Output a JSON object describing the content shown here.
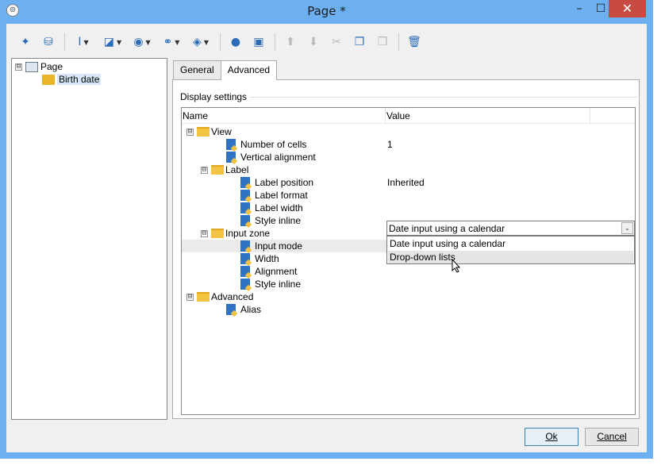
{
  "window": {
    "title": "Page *",
    "minimize_glyph": "–",
    "maximize_glyph": "☐",
    "close_glyph": "✕"
  },
  "toolbar": {
    "buttons": [
      {
        "name": "wizard-icon",
        "glyph": "✦",
        "enabled": true
      },
      {
        "name": "database-icon",
        "glyph": "⛁",
        "enabled": true
      },
      {
        "name": "text-cursor-icon",
        "glyph": "I",
        "enabled": true,
        "dropdown": true
      },
      {
        "name": "shapes-icon",
        "glyph": "◪",
        "enabled": true,
        "dropdown": true
      },
      {
        "name": "globe-icon",
        "glyph": "◉",
        "enabled": true,
        "dropdown": true
      },
      {
        "name": "link-icon",
        "glyph": "⚭",
        "enabled": true,
        "dropdown": true
      },
      {
        "name": "cube-icon",
        "glyph": "◈",
        "enabled": true,
        "dropdown": true
      },
      {
        "name": "user-icon",
        "glyph": "●",
        "enabled": true
      },
      {
        "name": "add-element-icon",
        "glyph": "▣",
        "enabled": true
      },
      {
        "name": "move-up-icon",
        "glyph": "⬆",
        "enabled": false
      },
      {
        "name": "move-down-icon",
        "glyph": "⬇",
        "enabled": false
      },
      {
        "name": "cut-icon",
        "glyph": "✂",
        "enabled": false
      },
      {
        "name": "copy-icon",
        "glyph": "❐",
        "enabled": true
      },
      {
        "name": "paste-icon",
        "glyph": "❒",
        "enabled": false
      },
      {
        "name": "delete-icon",
        "glyph": "🗑",
        "enabled": true
      }
    ]
  },
  "tree": {
    "root_label": "Page",
    "child_label": "Birth date",
    "root_expander": "⊟"
  },
  "tabs": [
    {
      "label": "General",
      "active": false
    },
    {
      "label": "Advanced",
      "active": true
    }
  ],
  "display_settings": {
    "group_label": "Display settings",
    "columns": {
      "name": "Name",
      "value": "Value"
    },
    "rows": [
      {
        "label": "View",
        "kind": "folder",
        "level": 0,
        "expander": "⊟",
        "value": ""
      },
      {
        "label": "Number of cells",
        "kind": "prop",
        "level": 1,
        "value": "1"
      },
      {
        "label": "Vertical alignment",
        "kind": "prop",
        "level": 1,
        "value": ""
      },
      {
        "label": "Label",
        "kind": "folder",
        "level": 1,
        "expander": "⊟",
        "value": ""
      },
      {
        "label": "Label position",
        "kind": "prop",
        "level": 2,
        "value": "Inherited"
      },
      {
        "label": "Label format",
        "kind": "prop",
        "level": 2,
        "value": ""
      },
      {
        "label": "Label width",
        "kind": "prop",
        "level": 2,
        "value": ""
      },
      {
        "label": "Style inline",
        "kind": "prop",
        "level": 2,
        "value": ""
      },
      {
        "label": "Input zone",
        "kind": "folder",
        "level": 1,
        "expander": "⊟",
        "value": ""
      },
      {
        "label": "Input mode",
        "kind": "prop",
        "level": 2,
        "value": "",
        "highlight": true
      },
      {
        "label": "Width",
        "kind": "prop",
        "level": 2,
        "value": ""
      },
      {
        "label": "Alignment",
        "kind": "prop",
        "level": 2,
        "value": ""
      },
      {
        "label": "Style inline",
        "kind": "prop",
        "level": 2,
        "value": ""
      },
      {
        "label": "Advanced",
        "kind": "folder",
        "level": 0,
        "expander": "⊟",
        "value": ""
      },
      {
        "label": "Alias",
        "kind": "prop",
        "level": 1,
        "value": ""
      }
    ],
    "input_mode_combo": {
      "selected": "Date input using a calendar",
      "arrow_glyph": "⌄",
      "options": [
        "Date input using a calendar",
        "Drop-down lists"
      ],
      "hovered_option": "Drop-down lists"
    }
  },
  "buttons": {
    "ok_label": "Ok",
    "cancel_label": "Cancel"
  }
}
